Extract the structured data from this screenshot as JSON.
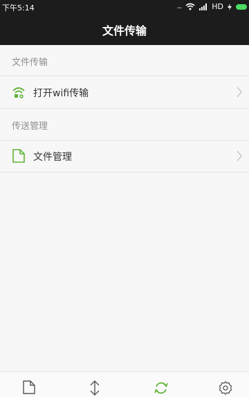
{
  "status_bar": {
    "time": "下午5:14",
    "signal_dots": "...",
    "network": "HD",
    "battery_color": "#4cd964"
  },
  "header": {
    "title": "文件传输"
  },
  "sections": [
    {
      "title": "文件传输",
      "items": [
        {
          "label": "打开wifi传输",
          "icon": "wifi-transfer-icon"
        }
      ]
    },
    {
      "title": "传送管理",
      "items": [
        {
          "label": "文件管理",
          "icon": "file-icon"
        }
      ]
    }
  ],
  "tab_bar": {
    "tabs": [
      {
        "icon": "file-icon",
        "active": false
      },
      {
        "icon": "transfer-arrows-icon",
        "active": false
      },
      {
        "icon": "sync-icon",
        "active": true
      },
      {
        "icon": "settings-gear-icon",
        "active": false
      }
    ]
  },
  "colors": {
    "accent": "#5fb336",
    "header_bg": "#1c1c1c",
    "icon_gray": "#555555"
  }
}
